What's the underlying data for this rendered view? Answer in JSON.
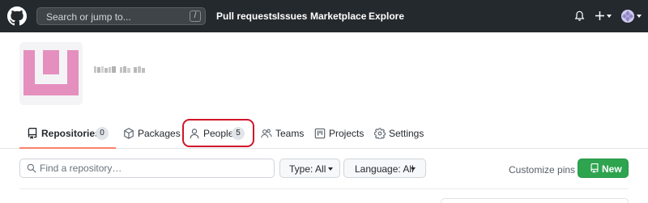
{
  "header": {
    "search_placeholder": "Search or jump to...",
    "search_shortcut": "/",
    "nav": [
      "Pull requests",
      "Issues",
      "Marketplace",
      "Explore"
    ]
  },
  "tabs": [
    {
      "label": "Repositories",
      "count": "0",
      "icon": "repo-icon",
      "selected": true
    },
    {
      "label": "Packages",
      "icon": "package-icon"
    },
    {
      "label": "People",
      "count": "5",
      "icon": "person-icon",
      "highlighted": true
    },
    {
      "label": "Teams",
      "icon": "people-icon"
    },
    {
      "label": "Projects",
      "icon": "project-icon"
    },
    {
      "label": "Settings",
      "icon": "gear-icon"
    }
  ],
  "filters": {
    "find_placeholder": "Find a repository…",
    "type_label": "Type: All",
    "language_label": "Language: All",
    "customize_pins": "Customize pins",
    "new_label": "New"
  },
  "colors": {
    "header_bg": "#24292e",
    "avatar_pink": "#e58fbe",
    "highlight_ring": "#d0142a",
    "tab_underline": "#f9826c",
    "new_button": "#2ea44f"
  }
}
